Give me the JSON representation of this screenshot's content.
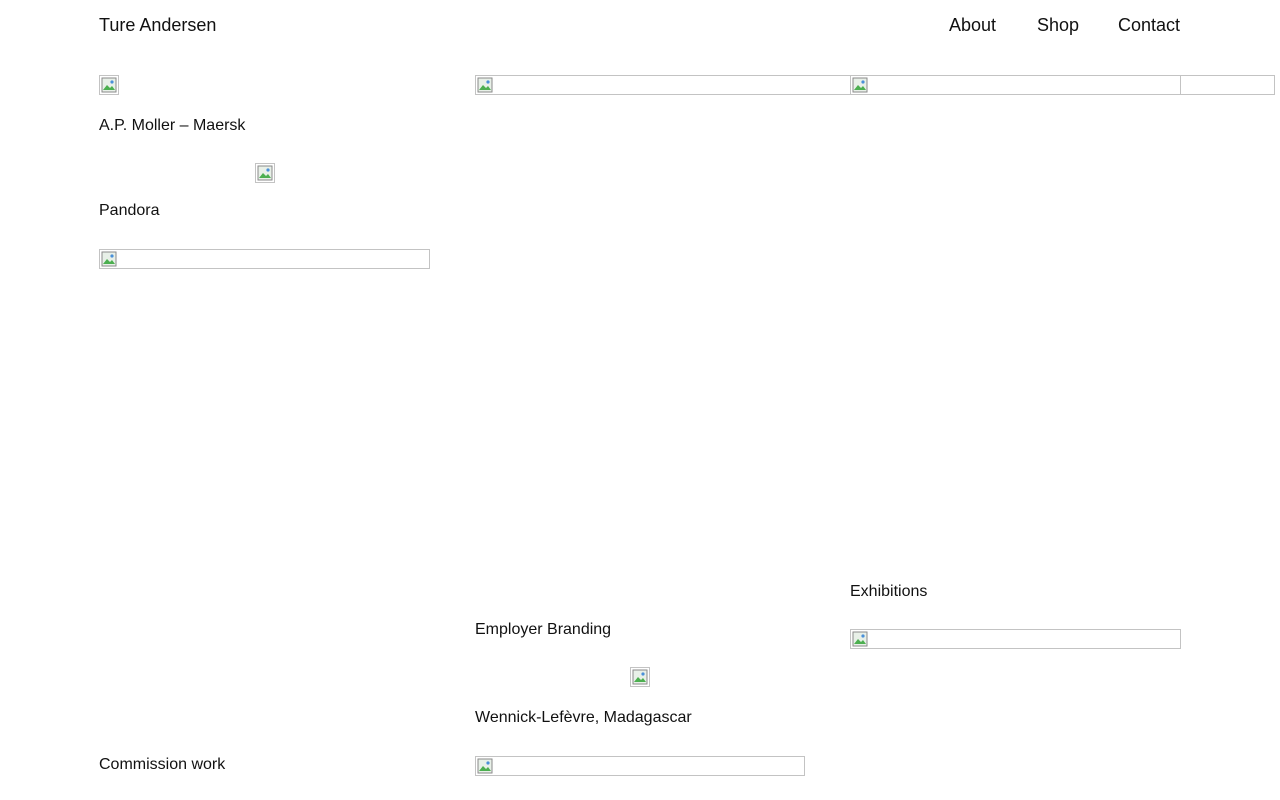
{
  "header": {
    "site_title": "Ture Andersen",
    "nav": [
      "About",
      "Shop",
      "Contact"
    ]
  },
  "projects": {
    "maersk": "A.P. Moller – Maersk",
    "pandora": "Pandora",
    "commission": "Commission work",
    "employer_branding": "Employer Branding",
    "wennick": "Wennick-Lefèvre, Madagascar",
    "exhibitions": "Exhibitions"
  },
  "icons": {
    "broken_image": "broken-image-icon"
  }
}
